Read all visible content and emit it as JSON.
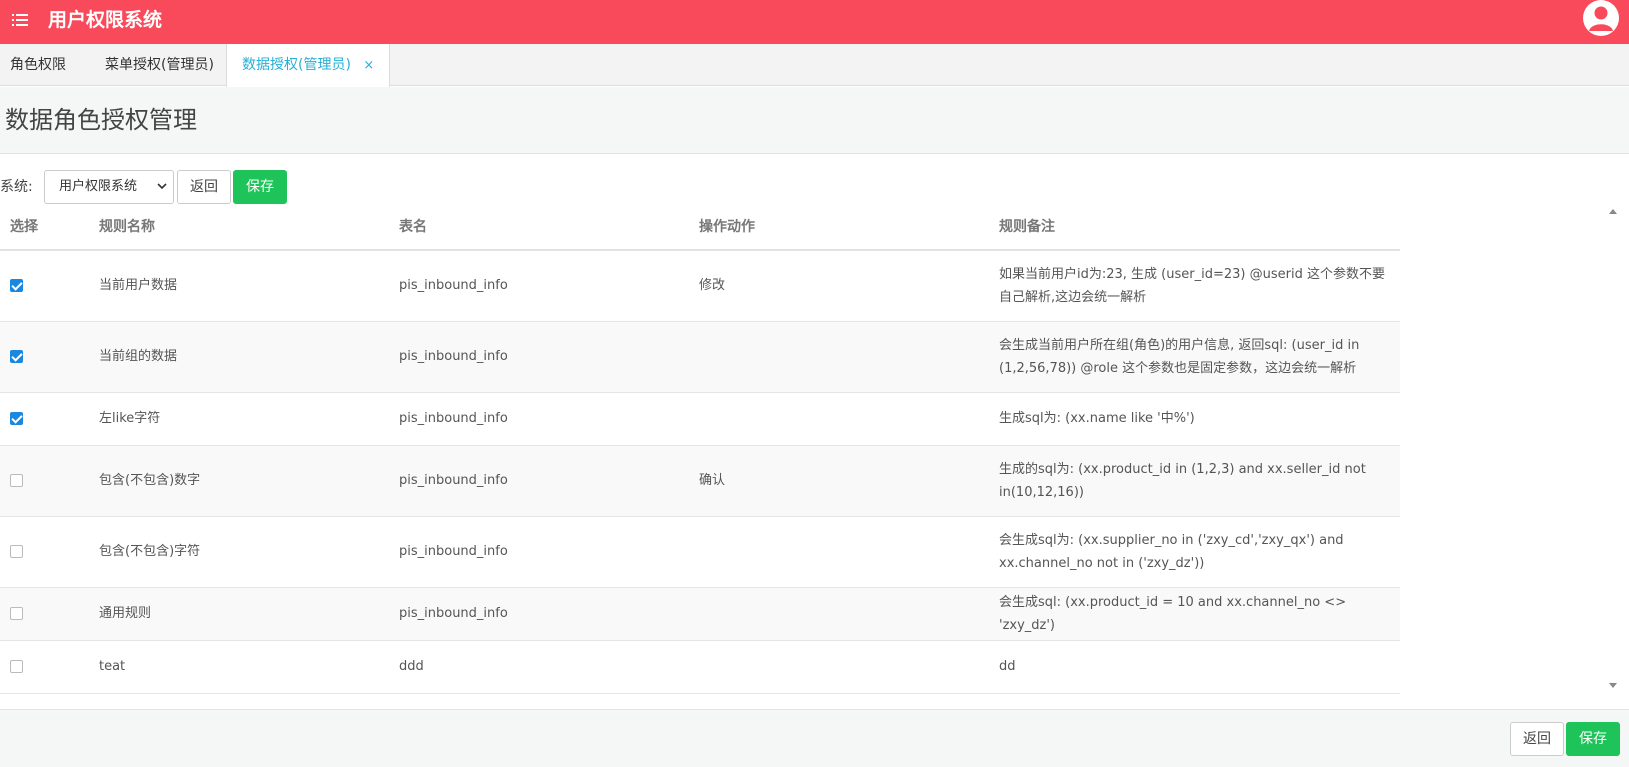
{
  "header": {
    "title": "用户权限系统",
    "menu_icon": "menu-icon",
    "avatar_icon": "user-avatar-icon",
    "color": "#f84a5a"
  },
  "tabs": [
    {
      "label": "角色权限"
    },
    {
      "label": "菜单授权(管理员)"
    },
    {
      "label": "数据授权(管理员)",
      "close": "×"
    }
  ],
  "page": {
    "title": "数据角色授权管理"
  },
  "toolbar": {
    "system_label": "系统:",
    "system_value": "用户权限系统",
    "back_label": "返回",
    "save_label": "保存"
  },
  "table": {
    "columns": [
      "选择",
      "规则名称",
      "表名",
      "操作动作",
      "规则备注"
    ],
    "rows": [
      {
        "checked": true,
        "name": "当前用户数据",
        "table": "pis_inbound_info",
        "action": "修改",
        "note": "如果当前用户id为:23, 生成 (user_id=23) @userid     这个参数不要自己解析,这边会统一解析"
      },
      {
        "checked": true,
        "name": "当前组的数据",
        "table": "pis_inbound_info",
        "action": "",
        "note": "会生成当前用户所在组(角色)的用户信息, 返回sql: (user_id in (1,2,56,78)) @role 这个参数也是固定参数，这边会统一解析"
      },
      {
        "checked": true,
        "name": "左like字符",
        "table": "pis_inbound_info",
        "action": "",
        "note": "生成sql为: (xx.name like '中%')"
      },
      {
        "checked": false,
        "name": "包含(不包含)数字",
        "table": "pis_inbound_info",
        "action": "确认",
        "note": "生成的sql为: (xx.product_id in (1,2,3) and xx.seller_id not in(10,12,16))"
      },
      {
        "checked": false,
        "name": "包含(不包含)字符",
        "table": "pis_inbound_info",
        "action": "",
        "note": "会生成sql为: (xx.supplier_no in ('zxy_cd','zxy_qx') and xx.channel_no not in ('zxy_dz'))"
      },
      {
        "checked": false,
        "name": "通用规则",
        "table": "pis_inbound_info",
        "action": "",
        "note": "会生成sql: (xx.product_id = 10 and xx.channel_no <> 'zxy_dz')"
      },
      {
        "checked": false,
        "name": "teat",
        "table": "ddd",
        "action": "",
        "note": "dd"
      }
    ]
  },
  "footer": {
    "back_label": "返回",
    "save_label": "保存"
  }
}
